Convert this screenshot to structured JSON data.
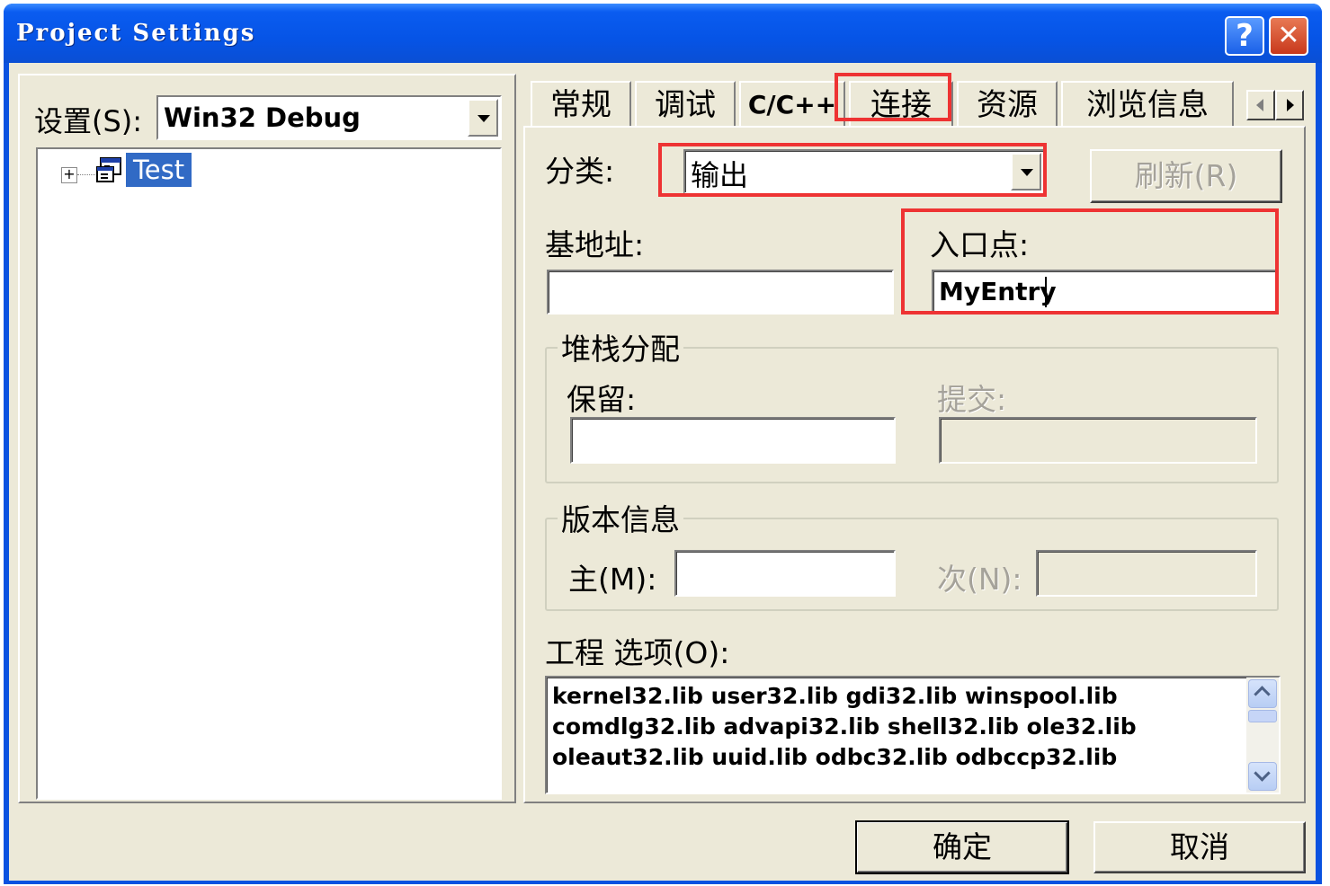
{
  "window": {
    "title": "Project Settings",
    "help_glyph": "?",
    "close_glyph": "✕"
  },
  "left": {
    "settings_label": "设置(S):",
    "config_value": "Win32 Debug",
    "tree": {
      "expander": "+",
      "node_label": "Test"
    }
  },
  "tabs": [
    {
      "label": "常规"
    },
    {
      "label": "调试"
    },
    {
      "label": "C/C++"
    },
    {
      "label": "连接",
      "active": true
    },
    {
      "label": "资源"
    },
    {
      "label": "浏览信息"
    }
  ],
  "link_page": {
    "category_label": "分类:",
    "category_value": "输出",
    "refresh_label": "刷新(R)",
    "base_address_label": "基地址:",
    "base_address_value": "",
    "entry_point_label": "入口点:",
    "entry_point_value": "MyEntry",
    "stack_group_title": "堆栈分配",
    "reserve_label": "保留:",
    "reserve_value": "",
    "commit_label": "提交:",
    "version_group_title": "版本信息",
    "major_label": "主(M):",
    "major_value": "",
    "minor_label": "次(N):",
    "project_options_label": "工程 选项(O):",
    "project_options_lines": [
      "kernel32.lib user32.lib gdi32.lib winspool.lib",
      "comdlg32.lib advapi32.lib shell32.lib ole32.lib",
      "oleaut32.lib uuid.lib odbc32.lib odbccp32.lib"
    ]
  },
  "buttons": {
    "ok": "确定",
    "cancel": "取消"
  },
  "colors": {
    "title_bar": "#0a52e0",
    "dialog_face": "#ece9d8",
    "selection": "#316ac5",
    "highlight_box": "#ee3333"
  }
}
